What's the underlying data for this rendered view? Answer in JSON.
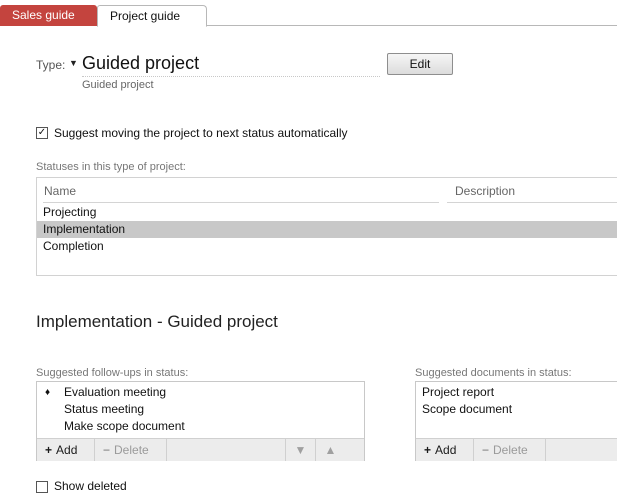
{
  "tabs": [
    {
      "label": "Sales guide",
      "active": false
    },
    {
      "label": "Project guide",
      "active": true
    }
  ],
  "type_header": {
    "label": "Type:",
    "value": "Guided project",
    "subtitle": "Guided project",
    "edit_button": "Edit"
  },
  "auto_status": {
    "checked": true,
    "label": "Suggest moving the project to next status automatically"
  },
  "statuses": {
    "label": "Statuses in this type of project:",
    "columns": [
      "Name",
      "Description"
    ],
    "rows": [
      {
        "name": "Projecting",
        "selected": false
      },
      {
        "name": "Implementation",
        "selected": true
      },
      {
        "name": "Completion",
        "selected": false
      }
    ]
  },
  "detail_title": "Implementation - Guided project",
  "followups": {
    "label": "Suggested follow-ups in status:",
    "items": [
      {
        "label": "Evaluation meeting",
        "marker": "♦"
      },
      {
        "label": "Status meeting",
        "marker": ""
      },
      {
        "label": "Make scope document",
        "marker": ""
      }
    ],
    "add_label": "Add",
    "delete_label": "Delete"
  },
  "documents": {
    "label": "Suggested documents in status:",
    "items": [
      "Project report",
      "Scope document"
    ],
    "add_label": "Add",
    "delete_label": "Delete"
  },
  "show_deleted": {
    "checked": false,
    "label": "Show deleted"
  },
  "colors": {
    "inactive_tab": "#c4443e",
    "selected_row": "#c8c8c8"
  }
}
